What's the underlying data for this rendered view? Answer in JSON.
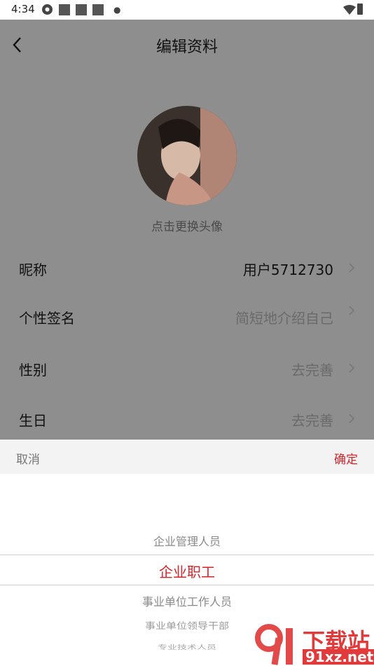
{
  "status_bar": {
    "time": "4:34"
  },
  "header": {
    "title": "编辑资料"
  },
  "avatar": {
    "hint": "点击更换头像"
  },
  "fields": [
    {
      "label": "昵称",
      "value": "用户5712730"
    },
    {
      "label": "个性签名",
      "value": "简短地介绍自己"
    },
    {
      "label": "性别",
      "value": "去完善"
    },
    {
      "label": "生日",
      "value": "去完善"
    }
  ],
  "picker": {
    "cancel": "取消",
    "confirm": "确定",
    "options": [
      "企业管理人员",
      "企业职工",
      "事业单位工作人员",
      "事业单位领导干部",
      "专业技术人员"
    ],
    "selected": "企业职工"
  },
  "watermark": {
    "text": "下载站",
    "domain": "91xz.net"
  },
  "colors": {
    "accent": "#d4242a",
    "overlay": "#8e8e8e",
    "sheet_bar": "#f3f3f3"
  }
}
